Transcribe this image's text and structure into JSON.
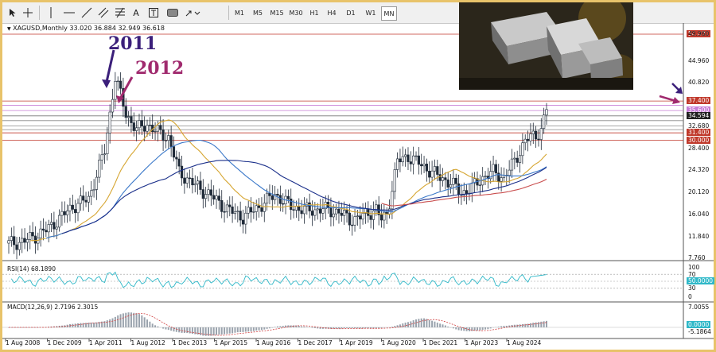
{
  "toolbar": {
    "timeframes": [
      "M1",
      "M5",
      "M15",
      "M30",
      "H1",
      "H4",
      "D1",
      "W1",
      "MN"
    ],
    "active_timeframe": "MN"
  },
  "chart": {
    "header": "XAGUSD,Monthly  33.020 36.884 32.949 36.618",
    "annotation_2011": "2011",
    "annotation_2012": "2012",
    "price_axis": [
      "50.000",
      "49.960",
      "44.960",
      "40.820",
      "37.400",
      "35.600",
      "34.594",
      "32.680",
      "31.400",
      "30.000",
      "28.400",
      "24.320",
      "20.120",
      "16.040",
      "11.840",
      "7.760"
    ],
    "highlighted_prices": [
      {
        "value": "50.000",
        "color": "#c0392b"
      },
      {
        "value": "37.400",
        "color": "#c0392b"
      },
      {
        "value": "35.600",
        "color": "#c77dd6"
      },
      {
        "value": "34.594",
        "color": "#222222"
      },
      {
        "value": "31.400",
        "color": "#c0392b"
      },
      {
        "value": "30.000",
        "color": "#c0392b"
      }
    ],
    "rsi_label": "RSI(14) 68.1890",
    "rsi_axis": [
      "100",
      "70",
      "50.0000",
      "30",
      "0"
    ],
    "macd_label": "MACD(12,26,9) 2.7196 2.3015",
    "macd_axis": [
      "7.0055",
      "0.0000",
      "-5.1864"
    ],
    "dates": [
      "1 Aug 2008",
      "1 Dec 2009",
      "1 Apr 2011",
      "1 Aug 2012",
      "1 Dec 2013",
      "1 Apr 2015",
      "1 Aug 2016",
      "1 Dec 2017",
      "1 Apr 2019",
      "1 Aug 2020",
      "1 Dec 2021",
      "1 Apr 2023",
      "1 Aug 2024"
    ]
  },
  "colors": {
    "candle": "#1f2a38",
    "ma_fast": "#d6a632",
    "ma_mid": "#3a78c9",
    "ma_slow": "#1a2f8a",
    "ma_red": "#c94d4d",
    "resistance": "#c0392b",
    "support_purple": "#c77dd6",
    "arrow_2011": "#3b1f7a",
    "arrow_2012": "#a02a6e",
    "frame": "#e8c36a"
  },
  "chart_data": {
    "type": "line",
    "x": [
      "1 Aug 2008",
      "1 Dec 2009",
      "1 Apr 2011",
      "1 Aug 2012",
      "1 Dec 2013",
      "1 Apr 2015",
      "1 Aug 2016",
      "1 Dec 2017",
      "1 Apr 2019",
      "1 Aug 2020",
      "1 Dec 2021",
      "1 Apr 2023",
      "1 Aug 2024"
    ],
    "series": [
      {
        "values": [
          10.5,
          17.5,
          42.0,
          28.0,
          19.5,
          16.5,
          19.8,
          16.5,
          15.0,
          26.0,
          23.0,
          24.0,
          28.5
        ]
      }
    ],
    "ylim": [
      7.76,
      50.0
    ]
  }
}
